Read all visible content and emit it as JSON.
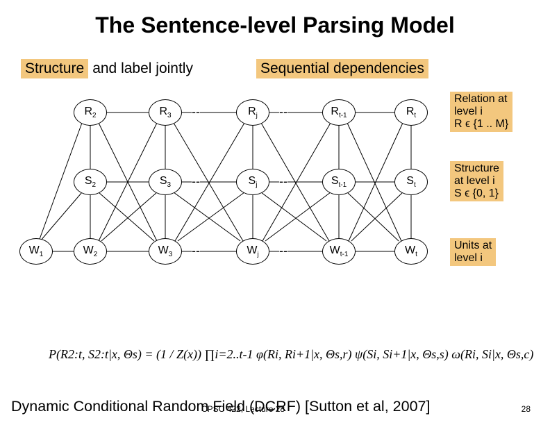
{
  "title": "The Sentence-level Parsing Model",
  "sublabel_left_hl": "Structure",
  "sublabel_left_rest": " and label jointly",
  "sublabel_right": "Sequential dependencies",
  "nodes": {
    "R2": "R",
    "R2s": "2",
    "R3": "R",
    "R3s": "3",
    "Rj": "R",
    "Rjs": "j",
    "Rt1": "R",
    "Rt1s": "t-1",
    "Rt": "R",
    "Rts": "t",
    "S2": "S",
    "S2s": "2",
    "S3": "S",
    "S3s": "3",
    "Sj": "S",
    "Sjs": "j",
    "St1": "S",
    "St1s": "t-1",
    "St": "S",
    "Sts": "t",
    "W1": "W",
    "W1s": "1",
    "W2": "W",
    "W2s": "2",
    "W3": "W",
    "W3s": "3",
    "Wj": "W",
    "Wjs": "j",
    "Wt1": "W",
    "Wt1s": "t-1",
    "Wt": "W",
    "Wts": "t"
  },
  "dots": "--",
  "annot_R_l1": "Relation at",
  "annot_R_l2": "level i",
  "annot_R_l3": "R ϵ {1 .. M}",
  "annot_S_l1": "Structure",
  "annot_S_l2": "at level i",
  "annot_S_l3": "S ϵ {0, 1}",
  "annot_W_l1": "Units at",
  "annot_W_l2": "level i",
  "formula_text": "P(R2:t, S2:t|x, Θs) = (1 / Z(x)) ∏i=2..t-1 φ(Ri, Ri+1|x, Θs,r) ψ(Si, Si+1|x, Θs,s) ω(Ri, Si|x, Θs,c)",
  "footer": "Dynamic Conditional Random Field (DCRF) [Sutton et al, 2007]",
  "smallprint": "CPSC 422, Lecture 28",
  "pagenum": "28"
}
